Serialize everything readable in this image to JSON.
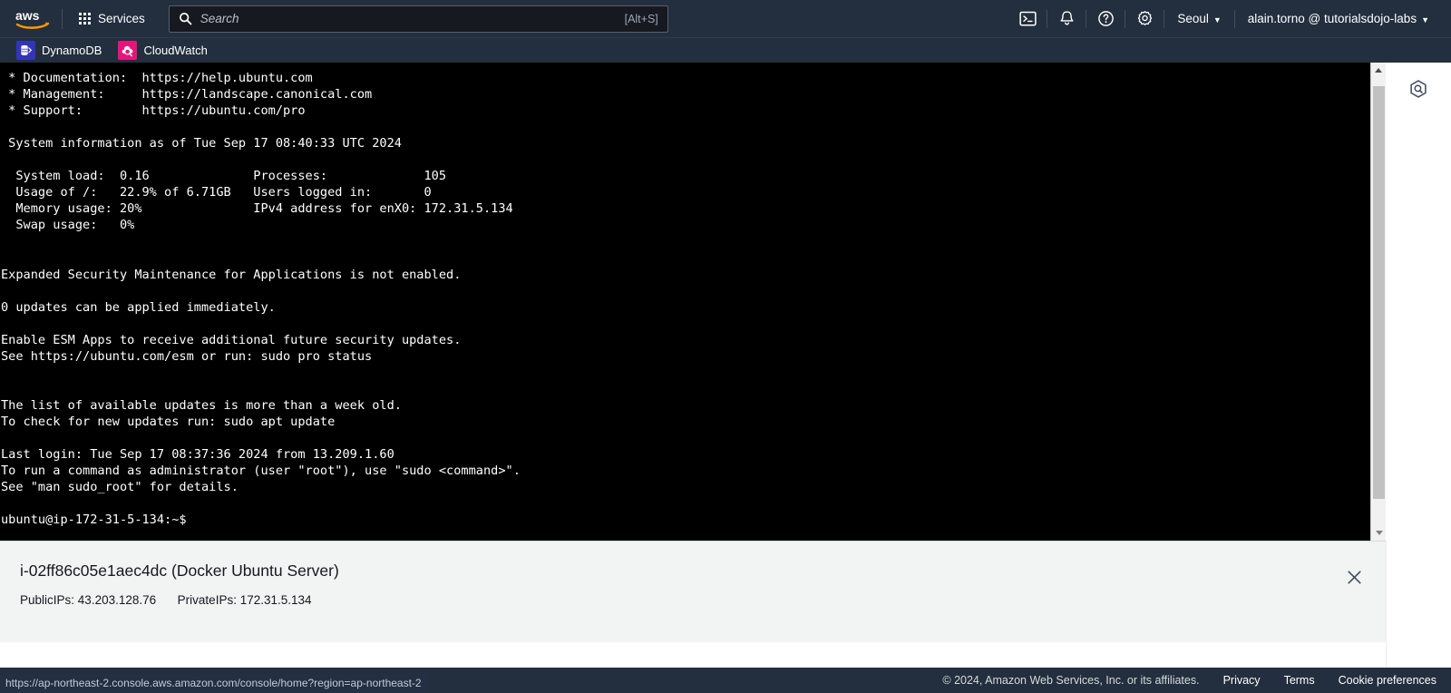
{
  "nav": {
    "logo_alt": "aws",
    "services_label": "Services",
    "search_placeholder": "Search",
    "search_value": "",
    "search_shortcut": "[Alt+S]",
    "cloudshell_icon": "cloudshell-icon",
    "notifications_icon": "bell-icon",
    "help_icon": "help-icon",
    "settings_icon": "gear-icon",
    "region": "Seoul",
    "account": "alain.torno @ tutorialsdojo-labs",
    "caret": "▼"
  },
  "favorites": [
    {
      "label": "DynamoDB",
      "icon": "dynamodb-icon",
      "color": "#3334B9"
    },
    {
      "label": "CloudWatch",
      "icon": "cloudwatch-icon",
      "color": "#E7157B"
    }
  ],
  "terminal": {
    "prompt_user": "ubuntu@ip-172-31-5-134:~$",
    "content": " * Documentation:  https://help.ubuntu.com\n * Management:     https://landscape.canonical.com\n * Support:        https://ubuntu.com/pro\n\n System information as of Tue Sep 17 08:40:33 UTC 2024\n\n  System load:  0.16              Processes:             105\n  Usage of /:   22.9% of 6.71GB   Users logged in:       0\n  Memory usage: 20%               IPv4 address for enX0: 172.31.5.134\n  Swap usage:   0%\n\n\nExpanded Security Maintenance for Applications is not enabled.\n\n0 updates can be applied immediately.\n\nEnable ESM Apps to receive additional future security updates.\nSee https://ubuntu.com/esm or run: sudo pro status\n\n\nThe list of available updates is more than a week old.\nTo check for new updates run: sudo apt update\n\nLast login: Tue Sep 17 08:37:36 2024 from 13.209.1.60\nTo run a command as administrator (user \"root\"), use \"sudo <command>\".\nSee \"man sudo_root\" for details.\n\nubuntu@ip-172-31-5-134:~$ "
  },
  "instance_panel": {
    "title": "i-02ff86c05e1aec4dc (Docker Ubuntu Server)",
    "public_ips_label": "PublicIPs:",
    "public_ips_value": "43.203.128.76",
    "private_ips_label": "PrivateIPs:",
    "private_ips_value": "172.31.5.134",
    "close_icon": "close-icon"
  },
  "right_rail": {
    "icon": "amazon-q-hexagon-icon"
  },
  "scrollbar": {
    "up_arrow": "chevron-up-icon",
    "down_arrow": "chevron-down-icon"
  },
  "footer": {
    "copyright": "© 2024, Amazon Web Services, Inc. or its affiliates.",
    "links": [
      "Privacy",
      "Terms",
      "Cookie preferences"
    ]
  },
  "status_bar": {
    "url": "https://ap-northeast-2.console.aws.amazon.com/console/home?region=ap-northeast-2"
  }
}
